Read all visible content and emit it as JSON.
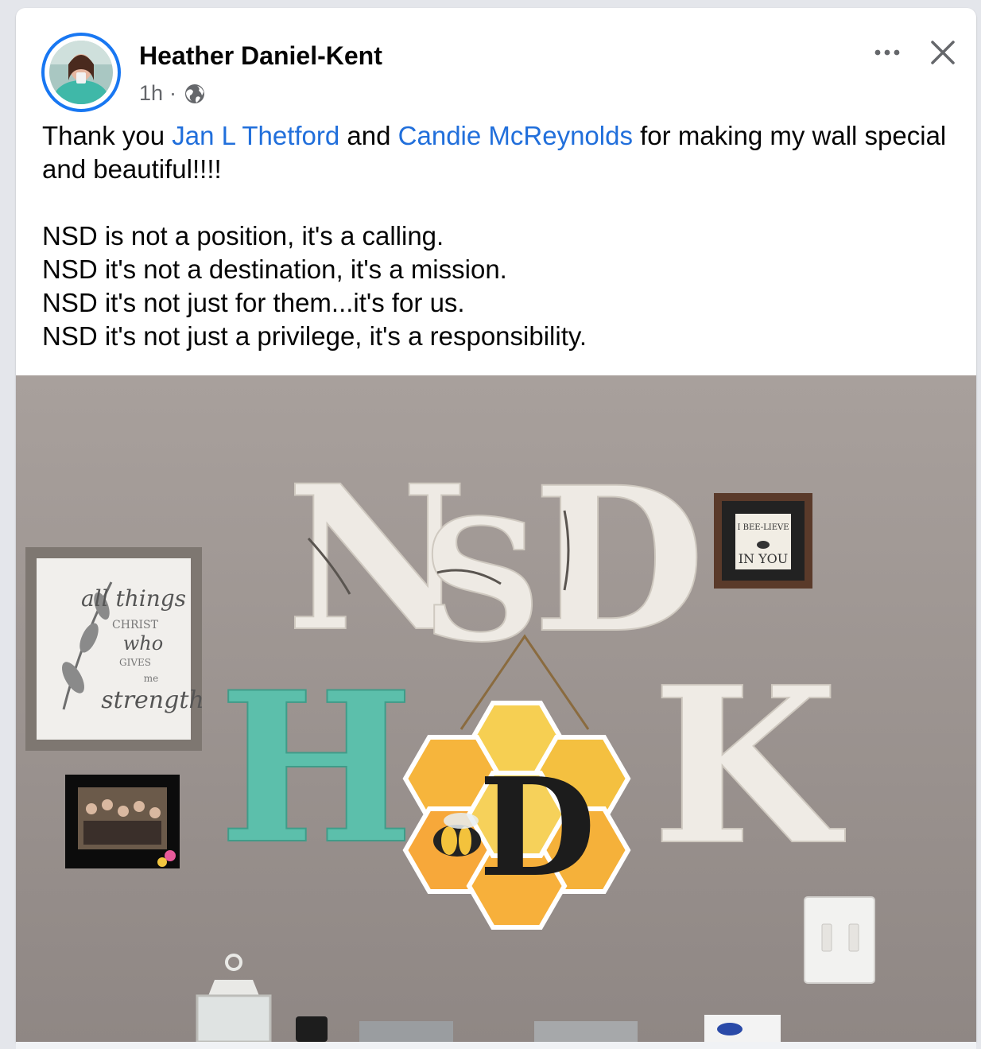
{
  "post": {
    "author": "Heather Daniel-Kent",
    "time": "1h",
    "separator": "·",
    "audience_icon": "globe-icon",
    "text_before_mentions": "Thank you ",
    "mention_1": "Jan L Thetford",
    "text_between_mentions": " and ",
    "mention_2": "Candie McReynolds",
    "text_after_mentions": " for making my wall special and beautiful!!!!",
    "lines": [
      "NSD is not a position, it's a calling.",
      "NSD it's not a destination, it's a mission.",
      "NSD it's not just for them...it's for us.",
      "NSD it's not just a privilege, it's a responsibility."
    ]
  },
  "header_actions": {
    "more_icon": "more-options-icon",
    "close_icon": "close-icon"
  },
  "colors": {
    "link": "#216fdb",
    "avatar_ring": "#1877f2",
    "secondary_text": "#65676b"
  },
  "photo": {
    "wall_letters": [
      "N",
      "S",
      "D",
      "H",
      "D",
      "K"
    ],
    "sign_text": [
      "all things",
      "CHRIST",
      "who",
      "GIVES",
      "me",
      "strength"
    ],
    "small_frame_text": [
      "I BEE-LIEVE",
      "IN YOU"
    ]
  }
}
